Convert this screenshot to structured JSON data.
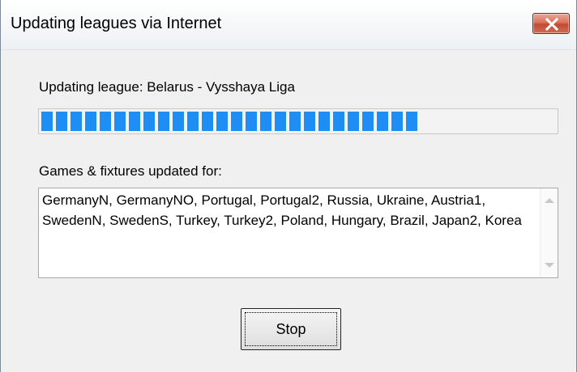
{
  "window": {
    "title": "Updating leagues via Internet",
    "close_icon": "close-icon",
    "close_color": "#c24b33"
  },
  "status": {
    "label": "Updating league:  Belarus - Vysshaya Liga"
  },
  "progress": {
    "fraction": 0.75,
    "color": "#1e8ef5"
  },
  "updated": {
    "label": "Games & fixtures updated for:",
    "text": "GermanyN, GermanyNO, Portugal, Portugal2, Russia, Ukraine, Austria1, SwedenN, SwedenS, Turkey, Turkey2, Poland, Hungary, Brazil, Japan2, Korea"
  },
  "buttons": {
    "stop_label": "Stop"
  }
}
